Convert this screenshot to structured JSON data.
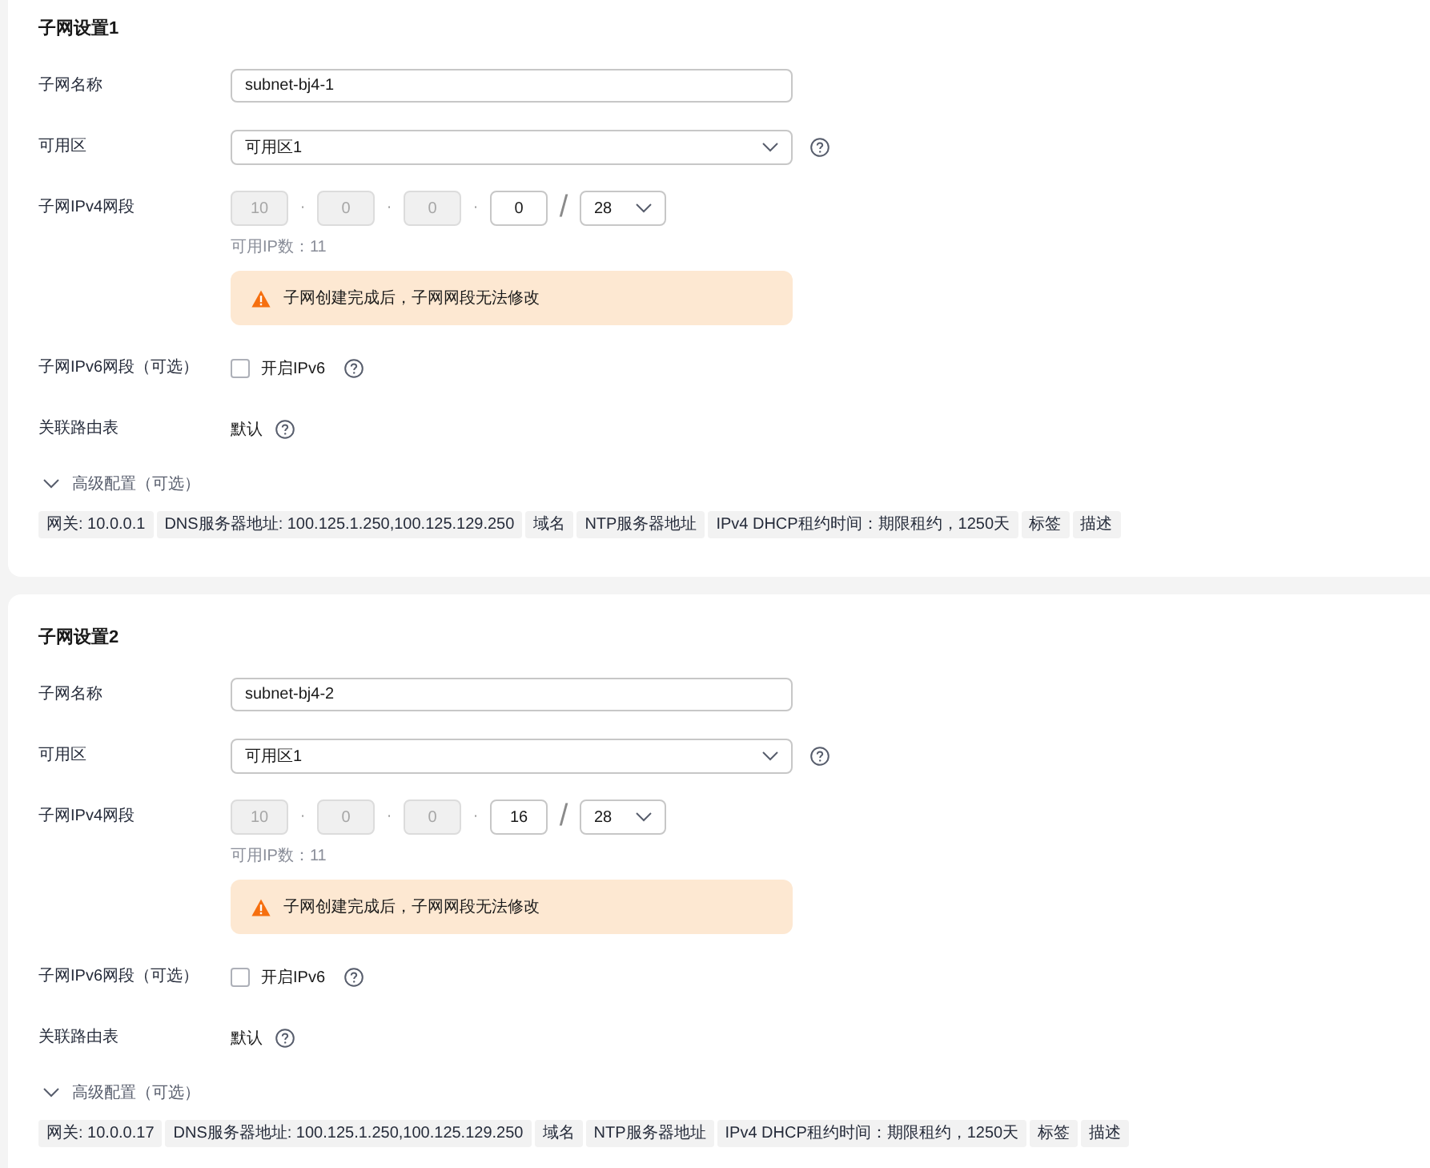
{
  "sections": [
    {
      "title": "子网设置1",
      "name": {
        "label": "子网名称",
        "value": "subnet-bj4-1"
      },
      "zone": {
        "label": "可用区",
        "value": "可用区1"
      },
      "ipv4": {
        "label": "子网IPv4网段",
        "octets": [
          {
            "value": "10",
            "disabled": true,
            "separator": "·"
          },
          {
            "value": "0",
            "disabled": true,
            "separator": "·"
          },
          {
            "value": "0",
            "disabled": true,
            "separator": "·"
          },
          {
            "value": "0",
            "disabled": false,
            "separator": "/"
          }
        ],
        "mask": "28",
        "hint": "可用IP数：11",
        "warning": "子网创建完成后，子网网段无法修改"
      },
      "ipv6": {
        "label": "子网IPv6网段（可选）",
        "option": "开启IPv6",
        "checked": false
      },
      "route_table": {
        "label": "关联路由表",
        "value": "默认"
      },
      "advanced": {
        "label": "高级配置（可选）",
        "expanded": false,
        "tags": [
          "网关: 10.0.0.1",
          "DNS服务器地址: 100.125.1.250,100.125.129.250",
          "域名",
          "NTP服务器地址",
          "IPv4 DHCP租约时间：期限租约，1250天",
          "标签",
          "描述"
        ]
      }
    },
    {
      "title": "子网设置2",
      "name": {
        "label": "子网名称",
        "value": "subnet-bj4-2"
      },
      "zone": {
        "label": "可用区",
        "value": "可用区1"
      },
      "ipv4": {
        "label": "子网IPv4网段",
        "octets": [
          {
            "value": "10",
            "disabled": true,
            "separator": "·"
          },
          {
            "value": "0",
            "disabled": true,
            "separator": "·"
          },
          {
            "value": "0",
            "disabled": true,
            "separator": "·"
          },
          {
            "value": "16",
            "disabled": false,
            "separator": "/"
          }
        ],
        "mask": "28",
        "hint": "可用IP数：11",
        "warning": "子网创建完成后，子网网段无法修改"
      },
      "ipv6": {
        "label": "子网IPv6网段（可选）",
        "option": "开启IPv6",
        "checked": false
      },
      "route_table": {
        "label": "关联路由表",
        "value": "默认"
      },
      "advanced": {
        "label": "高级配置（可选）",
        "expanded": false,
        "tags": [
          "网关: 10.0.0.17",
          "DNS服务器地址: 100.125.1.250,100.125.129.250",
          "域名",
          "NTP服务器地址",
          "IPv4 DHCP租约时间：期限租约，1250天",
          "标签",
          "描述"
        ]
      }
    }
  ]
}
